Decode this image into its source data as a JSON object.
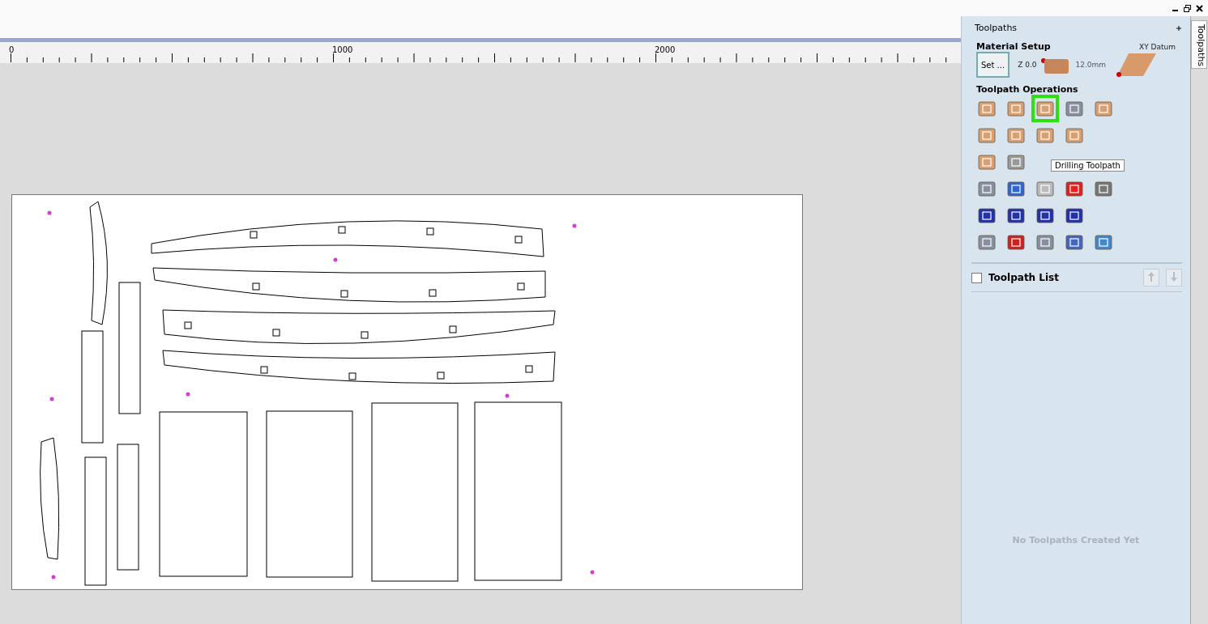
{
  "ruler": {
    "labels": [
      "0",
      "1000",
      "2000"
    ]
  },
  "panel": {
    "title": "Toolpaths",
    "side_tab": {
      "label": "Toolpaths",
      "selected": true
    },
    "material": {
      "heading": "Material Setup",
      "set_button": "Set ...",
      "z_label": "Z 0.0",
      "thickness": "12.0mm",
      "datum_heading": "XY Datum"
    },
    "operations": {
      "heading": "Toolpath Operations",
      "tooltip": "Drilling Toolpath",
      "rows": [
        [
          {
            "kind": "tile",
            "selected": false
          },
          {
            "kind": "tile",
            "selected": false
          },
          {
            "kind": "tile",
            "selected": true
          },
          {
            "kind": "tool",
            "selected": false
          },
          {
            "kind": "tile",
            "selected": false
          }
        ],
        [
          {
            "kind": "tile",
            "selected": false
          },
          {
            "kind": "tile",
            "selected": false
          },
          {
            "kind": "tile",
            "selected": false
          },
          {
            "kind": "tile",
            "selected": false
          }
        ],
        [
          {
            "kind": "tile",
            "selected": false
          },
          {
            "kind": "sphere",
            "selected": false
          }
        ],
        [
          {
            "kind": "tool",
            "selected": false
          },
          {
            "kind": "edit",
            "selected": false
          },
          {
            "kind": "copy",
            "selected": false
          },
          {
            "kind": "delete",
            "selected": false
          },
          {
            "kind": "calc",
            "selected": false
          }
        ],
        [
          {
            "kind": "hatch",
            "selected": false
          },
          {
            "kind": "hatch",
            "selected": false
          },
          {
            "kind": "hatch",
            "selected": false
          },
          {
            "kind": "hatch",
            "selected": false
          }
        ],
        [
          {
            "kind": "tool",
            "selected": false
          },
          {
            "kind": "clock",
            "selected": false
          },
          {
            "kind": "tool",
            "selected": false
          },
          {
            "kind": "save",
            "selected": false
          },
          {
            "kind": "export",
            "selected": false
          }
        ]
      ]
    },
    "list": {
      "title": "Toolpath List",
      "checked": false,
      "empty_message": "No Toolpaths Created Yet"
    }
  }
}
